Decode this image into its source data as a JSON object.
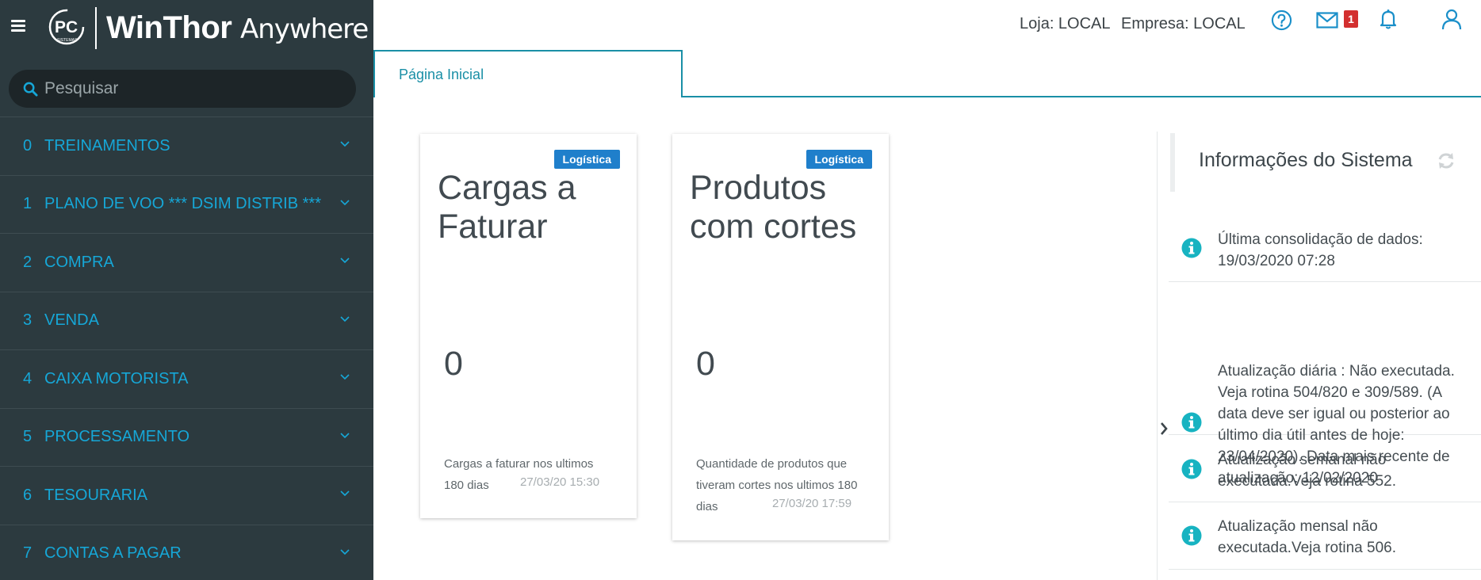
{
  "brand": {
    "logo_text": "PC",
    "logo_sub": "SISTEMAS",
    "name_bold": "WinThor",
    "name_light": "Anywhere"
  },
  "search": {
    "placeholder": "Pesquisar",
    "icon": "search-icon"
  },
  "menu": [
    {
      "num": "0",
      "label": "TREINAMENTOS"
    },
    {
      "num": "1",
      "label": "PLANO DE VOO *** DSIM DISTRIB ***"
    },
    {
      "num": "2",
      "label": "COMPRA"
    },
    {
      "num": "3",
      "label": "VENDA"
    },
    {
      "num": "4",
      "label": "CAIXA MOTORISTA"
    },
    {
      "num": "5",
      "label": "PROCESSAMENTO"
    },
    {
      "num": "6",
      "label": "TESOURARIA"
    },
    {
      "num": "7",
      "label": "CONTAS A PAGAR"
    }
  ],
  "header": {
    "loja": "Loja: LOCAL",
    "empresa": "Empresa: LOCAL",
    "mail_count": "1"
  },
  "tab": {
    "label": "Página Inicial"
  },
  "cards": [
    {
      "badge": "Logística",
      "title": "Cargas a Faturar",
      "value": "0",
      "desc": "Cargas a faturar nos ultimos 180 dias",
      "time": "27/03/20 15:30"
    },
    {
      "badge": "Logística",
      "title": "Produtos com cortes",
      "value": "0",
      "desc": "Quantidade de produtos que tiveram cortes nos ultimos 180 dias",
      "time": "27/03/20 17:59"
    }
  ],
  "info_panel": {
    "title": "Informações do Sistema",
    "items": [
      {
        "text": "Última consolidação de dados: 19/03/2020 07:28"
      },
      {
        "text": "Atualização diária : Não executada. Veja rotina 504/820 e 309/589. (A data deve ser igual ou posterior ao último dia útil antes de hoje: 23/04/2020). Data mais recente de atualização: 12/02/2020"
      },
      {
        "text": "Atualização semanal não executada.Veja rotina 552."
      },
      {
        "text": "Atualização mensal não executada.Veja rotina 506."
      }
    ]
  },
  "colors": {
    "sidebar": "#2c3a3f",
    "accent": "#16a7d7",
    "teal": "#1a8fa6",
    "badge": "#1f7fcb",
    "info_icon": "#17b3c1"
  }
}
